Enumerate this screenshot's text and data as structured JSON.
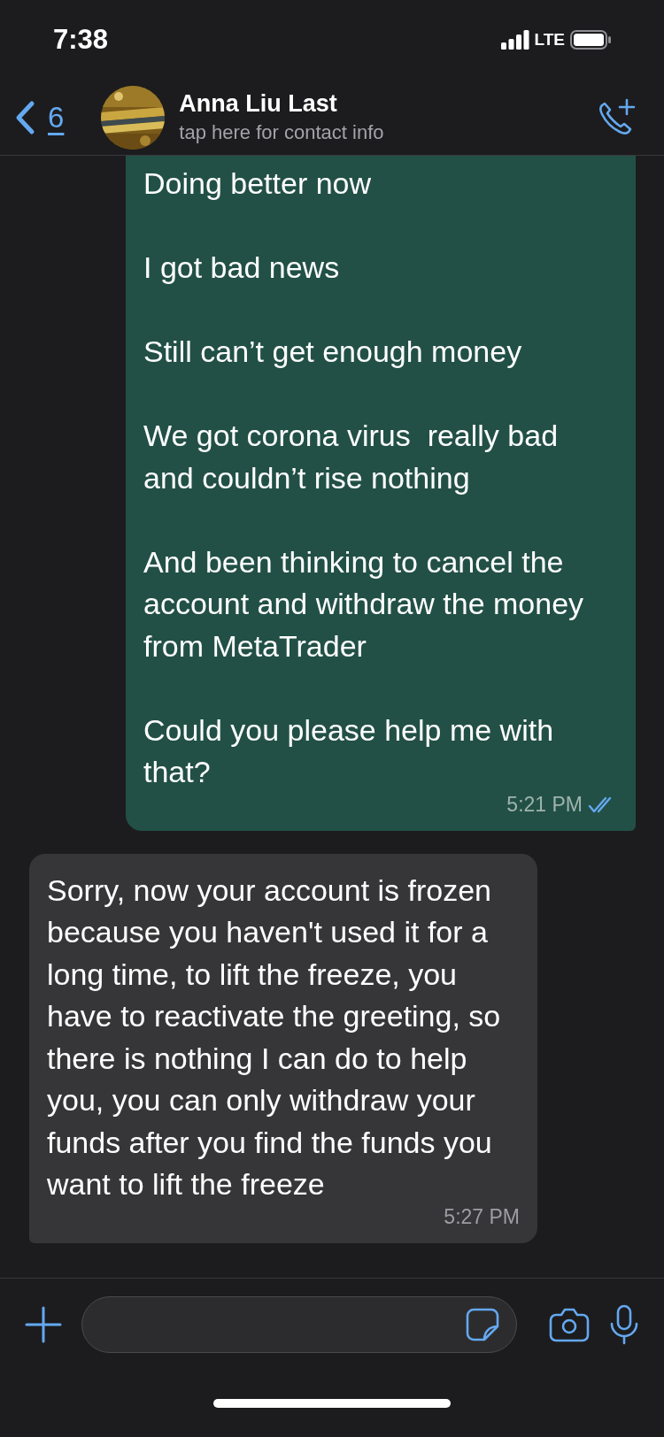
{
  "status_bar": {
    "time": "7:38",
    "network": "LTE"
  },
  "header": {
    "back_count": "6",
    "contact_name": "Anna Liu Last",
    "subtitle": "tap here for contact info"
  },
  "messages": [
    {
      "kind": "outgoing",
      "text": "Doing better now\n\nI got bad news\n\nStill can’t get enough money\n\nWe got corona virus  really bad  and couldn’t rise nothing\n\nAnd been thinking to cancel the account and withdraw the money from MetaTrader\n\nCould you please help me with that?",
      "time": "5:21 PM",
      "read": true
    },
    {
      "kind": "incoming",
      "text": "Sorry, now your account is frozen because you haven't used it for a long time, to lift the freeze, you have to reactivate the greeting, so there is nothing I can do to help you, you can only withdraw your funds after you find the funds you want to lift the freeze",
      "time": "5:27 PM"
    }
  ]
}
